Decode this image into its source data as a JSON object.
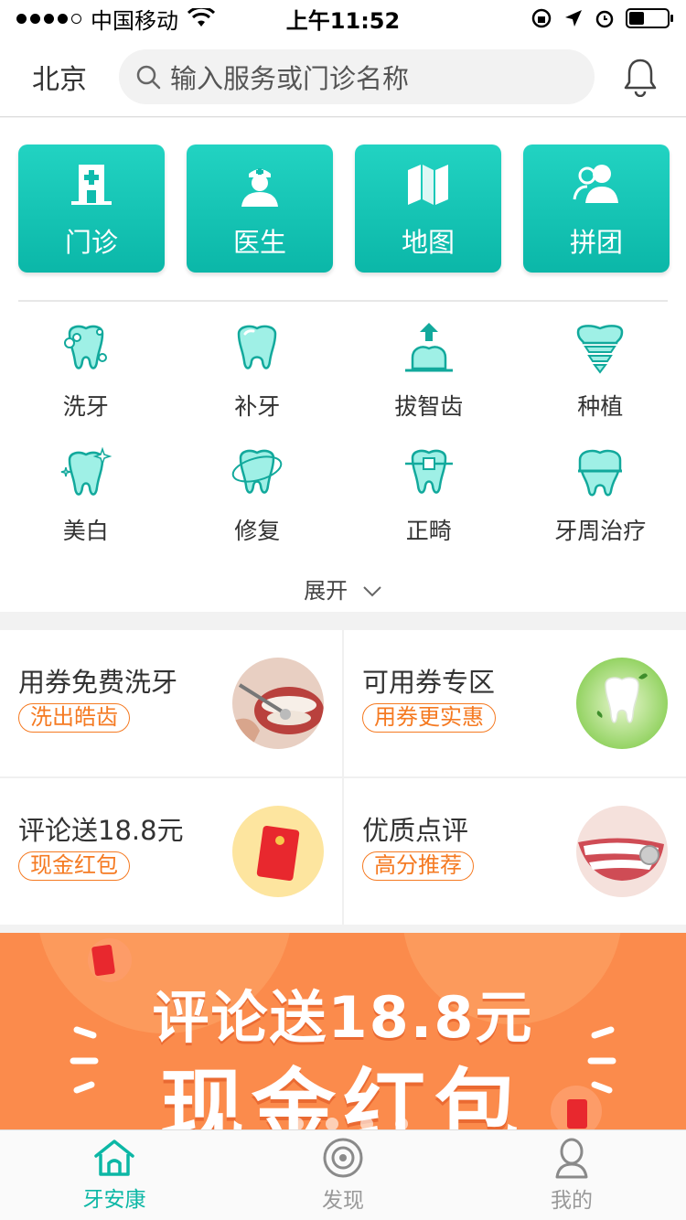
{
  "status_bar": {
    "carrier": "中国移动",
    "time": "上午11:52"
  },
  "header": {
    "city": "北京",
    "search_placeholder": "输入服务或门诊名称"
  },
  "quick_tiles": [
    {
      "label": "门诊",
      "icon": "clinic-icon"
    },
    {
      "label": "医生",
      "icon": "doctor-icon"
    },
    {
      "label": "地图",
      "icon": "map-icon"
    },
    {
      "label": "拼团",
      "icon": "group-icon"
    }
  ],
  "services": [
    {
      "label": "洗牙",
      "icon": "tooth-cleaning-icon"
    },
    {
      "label": "补牙",
      "icon": "tooth-filling-icon"
    },
    {
      "label": "拔智齿",
      "icon": "tooth-extraction-icon"
    },
    {
      "label": "种植",
      "icon": "tooth-implant-icon"
    },
    {
      "label": "美白",
      "icon": "tooth-whitening-icon"
    },
    {
      "label": "修复",
      "icon": "tooth-repair-icon"
    },
    {
      "label": "正畸",
      "icon": "tooth-braces-icon"
    },
    {
      "label": "牙周治疗",
      "icon": "periodontal-icon"
    }
  ],
  "expand_label": "展开",
  "promos": [
    {
      "title": "用券免费洗牙",
      "tag": "洗出皓齿"
    },
    {
      "title": "可用券专区",
      "tag": "用券更实惠"
    },
    {
      "title": "评论送18.8元",
      "tag": "现金红包"
    },
    {
      "title": "优质点评",
      "tag": "高分推荐"
    }
  ],
  "banner": {
    "line1": "评论送18.8元",
    "line2": "现金红包"
  },
  "tabs": [
    {
      "label": "牙安康",
      "icon": "home-icon",
      "active": true
    },
    {
      "label": "发现",
      "icon": "discover-icon",
      "active": false
    },
    {
      "label": "我的",
      "icon": "profile-icon",
      "active": false
    }
  ],
  "colors": {
    "accent": "#0cb7a5",
    "orange": "#f57a22",
    "banner": "#fb8b4c"
  }
}
